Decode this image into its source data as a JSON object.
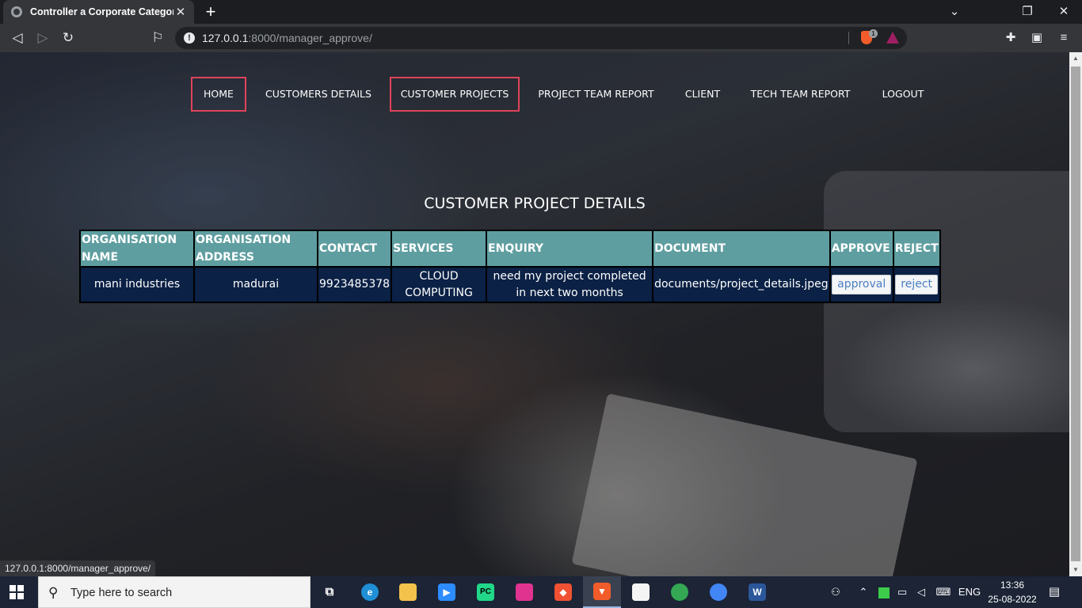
{
  "browser": {
    "tab_title": "Controller a Corporate Category P",
    "tab_close": "✕",
    "new_tab": "+",
    "url_host": "127.0.0.1",
    "url_rest": ":8000/manager_approve/",
    "shields_count": "1",
    "status_url": "127.0.0.1:8000/manager_approve/"
  },
  "nav": {
    "items": [
      {
        "label": "HOME"
      },
      {
        "label": "CUSTOMERS DETAILS"
      },
      {
        "label": "CUSTOMER PROJECTS"
      },
      {
        "label": "PROJECT TEAM REPORT"
      },
      {
        "label": "CLIENT"
      },
      {
        "label": "TECH TEAM REPORT"
      },
      {
        "label": "LOGOUT"
      }
    ]
  },
  "page": {
    "title": "CUSTOMER PROJECT DETAILS"
  },
  "table": {
    "headers": [
      "ORGANISATION NAME",
      "ORGANISATION ADDRESS",
      "CONTACT",
      "SERVICES",
      "ENQUIRY",
      "DOCUMENT",
      "APPROVE",
      "REJECT"
    ],
    "rows": [
      {
        "organisation_name": "mani industries",
        "organisation_address": "madurai",
        "contact": "9923485378",
        "services": "CLOUD COMPUTING",
        "enquiry": "need my project completed in next two months",
        "document": "documents/project_details.jpeg",
        "approve_label": "approval",
        "reject_label": "reject"
      }
    ]
  },
  "taskbar": {
    "search_placeholder": "Type here to search",
    "language": "ENG",
    "time": "13:36",
    "date": "25-08-2022"
  },
  "colors": {
    "nav_highlight_border": "#e0435a",
    "table_header_bg": "#5f9ea0",
    "table_row_bg": "#0b2145",
    "button_text": "#4a7fc1"
  }
}
